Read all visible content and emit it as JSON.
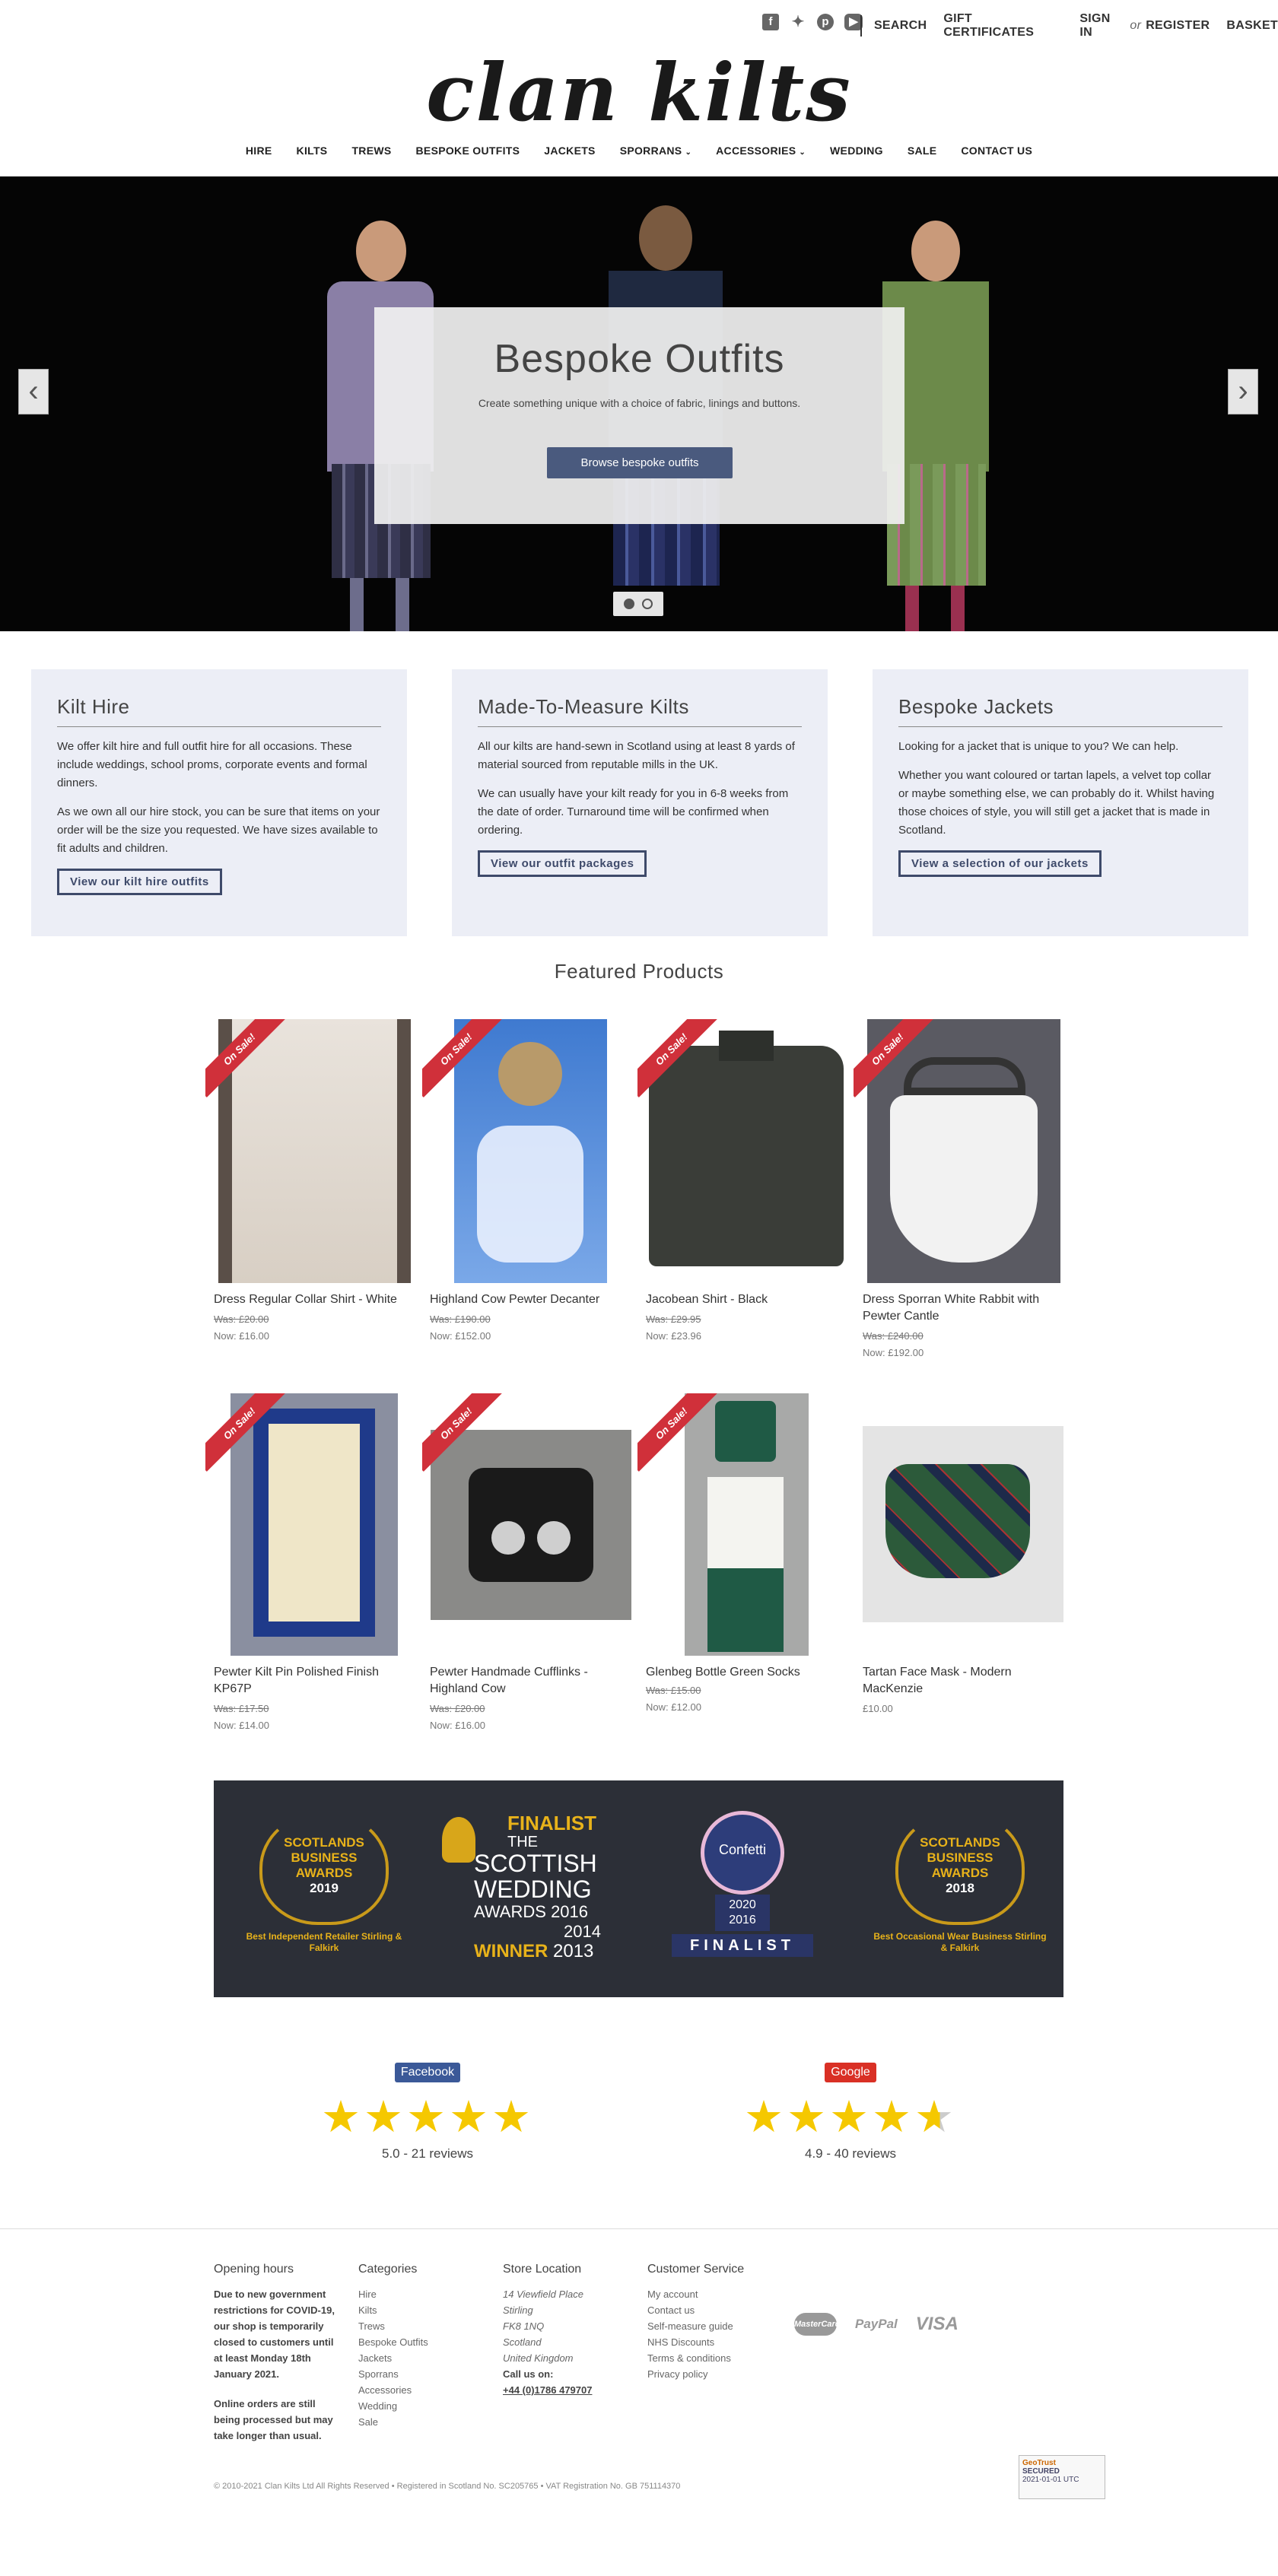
{
  "header": {
    "links": {
      "search": "SEARCH",
      "gift": "GIFT CERTIFICATES",
      "signin": "SIGN IN",
      "or": "or",
      "register": "REGISTER",
      "basket": "BASKET"
    },
    "logo": "clan kilts",
    "social_icons": [
      "facebook-icon",
      "twitter-icon",
      "pinterest-icon",
      "youtube-icon"
    ]
  },
  "nav": [
    "HIRE",
    "KILTS",
    "TREWS",
    "BESPOKE OUTFITS",
    "JACKETS",
    "SPORRANS",
    "ACCESSORIES",
    "WEDDING",
    "SALE",
    "CONTACT US"
  ],
  "hero": {
    "title": "Bespoke Outfits",
    "subtitle": "Create something unique with a choice of fabric, linings and buttons.",
    "button": "Browse bespoke outfits"
  },
  "boxes": [
    {
      "title": "Kilt Hire",
      "p1": "We offer kilt hire and full outfit hire for all occasions. These include weddings, school proms, corporate events and formal dinners.",
      "p2": "As we own all our hire stock, you can be sure that items on your order will be the size you requested. We have sizes available to fit adults and children.",
      "button": "View our kilt hire outfits"
    },
    {
      "title": "Made-To-Measure Kilts",
      "p1": "All our kilts are hand-sewn in Scotland using at least 8 yards of material sourced from reputable mills in the UK.",
      "p2": "We can usually have your kilt ready for you in 6-8 weeks from the date of order. Turnaround time will be confirmed when ordering.",
      "button": "View our outfit packages"
    },
    {
      "title": "Bespoke Jackets",
      "p1": "Looking for a jacket that is unique to you? We can help.",
      "p2": "Whether you want coloured or tartan lapels, a velvet top collar or maybe something else, we can probably do it. Whilst having those choices of style, you will still get a jacket that is made in Scotland.",
      "button": "View a selection of our jackets"
    }
  ],
  "featured_title": "Featured Products",
  "sale_label": "On Sale!",
  "products": [
    {
      "name": "Dress Regular Collar Shirt - White",
      "was": "Was: £20.00",
      "now": "Now: £16.00"
    },
    {
      "name": "Highland Cow Pewter Decanter",
      "was": "Was: £190.00",
      "now": "Now: £152.00"
    },
    {
      "name": "Jacobean Shirt - Black",
      "was": "Was: £29.95",
      "now": "Now: £23.96"
    },
    {
      "name": "Dress Sporran White Rabbit with Pewter Cantle",
      "was": "Was: £240.00",
      "now": "Now: £192.00"
    },
    {
      "name": "Pewter Kilt Pin Polished Finish KP67P",
      "was": "Was: £17.50",
      "now": "Now: £14.00"
    },
    {
      "name": "Pewter Handmade Cufflinks - Highland Cow",
      "was": "Was: £20.00",
      "now": "Now: £16.00"
    },
    {
      "name": "Glenbeg Bottle Green Socks",
      "was": "Was: £15.00",
      "now": "Now: £12.00"
    },
    {
      "name": "Tartan Face Mask - Modern MacKenzie",
      "price": "£10.00"
    }
  ],
  "awards": {
    "a1": {
      "l1": "SCOTLANDS",
      "l2": "BUSINESS",
      "l3": "AWARDS",
      "year": "2019",
      "cap": "Best Independent Retailer Stirling & Falkirk"
    },
    "a2": {
      "finalist": "FINALIST",
      "the": "THE",
      "l1": "SCOTTISH",
      "l2": "WEDDING",
      "awards": "AWARDS",
      "y1": "2016",
      "y2": "2014",
      "winner": "WINNER",
      "y3": "2013"
    },
    "a3": {
      "brand": "Confetti",
      "y1": "2020",
      "y2": "2016",
      "finalist": "FINALIST"
    },
    "a4": {
      "l1": "SCOTLANDS",
      "l2": "BUSINESS",
      "l3": "AWARDS",
      "year": "2018",
      "cap": "Best Occasional Wear Business Stirling & Falkirk"
    }
  },
  "reviews": [
    {
      "source": "Facebook",
      "color": "#3b5998",
      "rating": 5.0,
      "text": "5.0 - 21 reviews"
    },
    {
      "source": "Google",
      "color": "#d93025",
      "rating": 4.9,
      "text": "4.9 - 40 reviews"
    }
  ],
  "footer": {
    "hours": {
      "title": "Opening hours",
      "notice": "Due to new government restrictions for COVID-19, our shop is temporarily closed to customers until at least Monday 18th January 2021.",
      "online": "Online orders are still being processed but may take longer than usual."
    },
    "categories": {
      "title": "Categories",
      "items": [
        "Hire",
        "Kilts",
        "Trews",
        "Bespoke Outfits",
        "Jackets",
        "Sporrans",
        "Accessories",
        "Wedding",
        "Sale"
      ]
    },
    "store": {
      "title": "Store Location",
      "lines": [
        "14 Viewfield Place",
        "Stirling",
        "FK8 1NQ",
        "Scotland",
        "United Kingdom"
      ],
      "call": "Call us on:",
      "phone": "+44 (0)1786 479707"
    },
    "service": {
      "title": "Customer Service",
      "items": [
        "My account",
        "Contact us",
        "Self-measure guide",
        "NHS Discounts",
        "Terms & conditions",
        "Privacy policy"
      ]
    },
    "payments": {
      "mastercard": "MasterCard",
      "paypal": "PayPal",
      "visa": "VISA"
    },
    "copyright": "© 2010-2021 Clan Kilts Ltd All Rights Reserved • Registered in Scotland No. SC205765 • VAT Registration No. GB 751114370",
    "geotrust": {
      "l1": "GeoTrust",
      "l2": "SECURED",
      "l3": "2021-01-01 UTC"
    }
  }
}
